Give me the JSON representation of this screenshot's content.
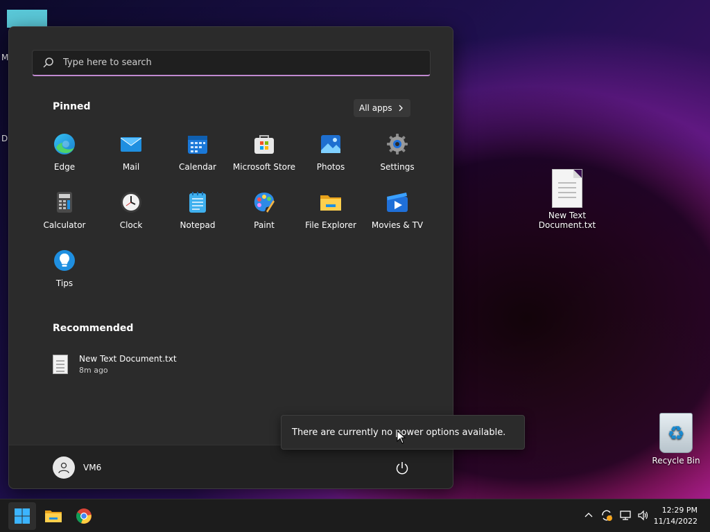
{
  "desktop": {
    "left_edge_label_1": "M",
    "left_edge_label_2": "Da",
    "icons": [
      {
        "label": "New Text Document.txt",
        "icon": "text-file-icon"
      },
      {
        "label": "Recycle Bin",
        "icon": "recycle-bin-icon"
      }
    ]
  },
  "start_menu": {
    "search": {
      "placeholder": "Type here to search"
    },
    "pinned": {
      "title": "Pinned",
      "all_apps_label": "All apps",
      "apps": [
        {
          "label": "Edge",
          "icon": "edge-icon"
        },
        {
          "label": "Mail",
          "icon": "mail-icon"
        },
        {
          "label": "Calendar",
          "icon": "calendar-icon"
        },
        {
          "label": "Microsoft Store",
          "icon": "store-icon"
        },
        {
          "label": "Photos",
          "icon": "photos-icon"
        },
        {
          "label": "Settings",
          "icon": "settings-icon"
        },
        {
          "label": "Calculator",
          "icon": "calculator-icon"
        },
        {
          "label": "Clock",
          "icon": "clock-icon"
        },
        {
          "label": "Notepad",
          "icon": "notepad-icon"
        },
        {
          "label": "Paint",
          "icon": "paint-icon"
        },
        {
          "label": "File Explorer",
          "icon": "folder-icon"
        },
        {
          "label": "Movies & TV",
          "icon": "movies-icon"
        },
        {
          "label": "Tips",
          "icon": "lightbulb-icon"
        }
      ]
    },
    "recommended": {
      "title": "Recommended",
      "items": [
        {
          "name": "New Text Document.txt",
          "time": "8m ago"
        }
      ]
    },
    "user": {
      "name": "VM6"
    }
  },
  "tooltip": {
    "text": "There are currently no power options available."
  },
  "taskbar": {
    "clock": {
      "time": "12:29 PM",
      "date": "11/14/2022"
    },
    "tray_icons": [
      "chevron-up-icon",
      "update-icon",
      "network-icon",
      "volume-icon"
    ]
  },
  "colors": {
    "accent": "#c18ad0",
    "menu_bg": "#2b2b2b",
    "taskbar_bg": "#1c1c1c"
  }
}
